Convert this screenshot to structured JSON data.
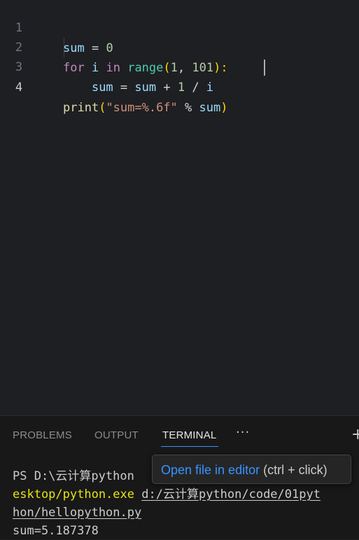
{
  "editor": {
    "line_numbers": [
      "1",
      "2",
      "3",
      "4"
    ],
    "lines": [
      {
        "tokens": [
          "sum",
          " = ",
          "0"
        ]
      },
      {
        "tokens": [
          "for",
          " ",
          "i",
          " ",
          "in",
          " ",
          "range",
          "(",
          "1",
          ", ",
          "101",
          "):"
        ]
      },
      {
        "tokens": [
          "    ",
          "sum",
          " = ",
          "sum",
          " + ",
          "1",
          " / ",
          "i"
        ]
      },
      {
        "tokens": [
          "print",
          "(",
          "\"sum=%.6f\"",
          " % ",
          "sum",
          ")"
        ]
      }
    ]
  },
  "panel": {
    "tabs": [
      "PROBLEMS",
      "OUTPUT",
      "TERMINAL"
    ],
    "active_tab": "TERMINAL",
    "more_label": "···",
    "new_label": "+"
  },
  "terminal": {
    "line1_prompt": "PS D:\\云计算python",
    "line2_exe": "esktop/python.exe",
    "line2_path": "d:/云计算python/code/01pyt",
    "line3_path": "hon/hellopython.py",
    "line4_output": "sum=5.187378"
  },
  "tooltip": {
    "link_text": "Open file in editor",
    "hint_text": " (ctrl + click)"
  },
  "colors": {
    "keyword": "#c586c0",
    "variable": "#9cdcfe",
    "function": "#dcdcaa",
    "number": "#b5cea8",
    "string": "#ce9178",
    "accent": "#3794ff"
  }
}
